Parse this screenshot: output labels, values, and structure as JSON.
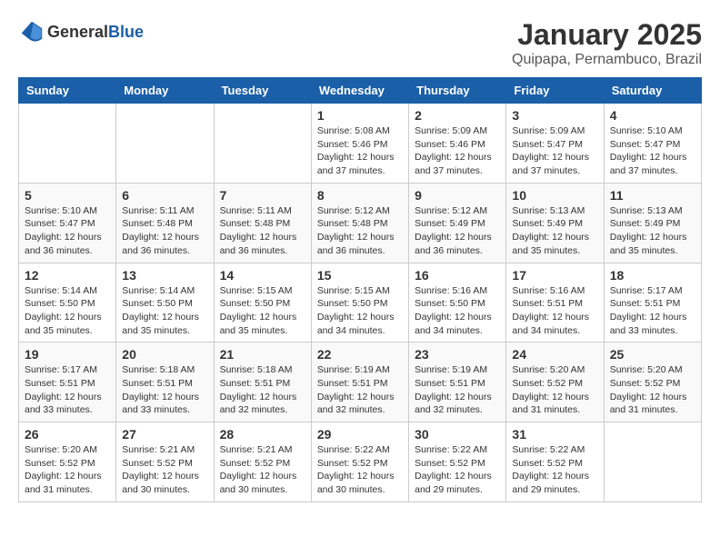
{
  "header": {
    "logo_general": "General",
    "logo_blue": "Blue",
    "title": "January 2025",
    "subtitle": "Quipapa, Pernambuco, Brazil"
  },
  "weekdays": [
    "Sunday",
    "Monday",
    "Tuesday",
    "Wednesday",
    "Thursday",
    "Friday",
    "Saturday"
  ],
  "weeks": [
    [
      {
        "day": "",
        "info": ""
      },
      {
        "day": "",
        "info": ""
      },
      {
        "day": "",
        "info": ""
      },
      {
        "day": "1",
        "info": "Sunrise: 5:08 AM\nSunset: 5:46 PM\nDaylight: 12 hours\nand 37 minutes."
      },
      {
        "day": "2",
        "info": "Sunrise: 5:09 AM\nSunset: 5:46 PM\nDaylight: 12 hours\nand 37 minutes."
      },
      {
        "day": "3",
        "info": "Sunrise: 5:09 AM\nSunset: 5:47 PM\nDaylight: 12 hours\nand 37 minutes."
      },
      {
        "day": "4",
        "info": "Sunrise: 5:10 AM\nSunset: 5:47 PM\nDaylight: 12 hours\nand 37 minutes."
      }
    ],
    [
      {
        "day": "5",
        "info": "Sunrise: 5:10 AM\nSunset: 5:47 PM\nDaylight: 12 hours\nand 36 minutes."
      },
      {
        "day": "6",
        "info": "Sunrise: 5:11 AM\nSunset: 5:48 PM\nDaylight: 12 hours\nand 36 minutes."
      },
      {
        "day": "7",
        "info": "Sunrise: 5:11 AM\nSunset: 5:48 PM\nDaylight: 12 hours\nand 36 minutes."
      },
      {
        "day": "8",
        "info": "Sunrise: 5:12 AM\nSunset: 5:48 PM\nDaylight: 12 hours\nand 36 minutes."
      },
      {
        "day": "9",
        "info": "Sunrise: 5:12 AM\nSunset: 5:49 PM\nDaylight: 12 hours\nand 36 minutes."
      },
      {
        "day": "10",
        "info": "Sunrise: 5:13 AM\nSunset: 5:49 PM\nDaylight: 12 hours\nand 35 minutes."
      },
      {
        "day": "11",
        "info": "Sunrise: 5:13 AM\nSunset: 5:49 PM\nDaylight: 12 hours\nand 35 minutes."
      }
    ],
    [
      {
        "day": "12",
        "info": "Sunrise: 5:14 AM\nSunset: 5:50 PM\nDaylight: 12 hours\nand 35 minutes."
      },
      {
        "day": "13",
        "info": "Sunrise: 5:14 AM\nSunset: 5:50 PM\nDaylight: 12 hours\nand 35 minutes."
      },
      {
        "day": "14",
        "info": "Sunrise: 5:15 AM\nSunset: 5:50 PM\nDaylight: 12 hours\nand 35 minutes."
      },
      {
        "day": "15",
        "info": "Sunrise: 5:15 AM\nSunset: 5:50 PM\nDaylight: 12 hours\nand 34 minutes."
      },
      {
        "day": "16",
        "info": "Sunrise: 5:16 AM\nSunset: 5:50 PM\nDaylight: 12 hours\nand 34 minutes."
      },
      {
        "day": "17",
        "info": "Sunrise: 5:16 AM\nSunset: 5:51 PM\nDaylight: 12 hours\nand 34 minutes."
      },
      {
        "day": "18",
        "info": "Sunrise: 5:17 AM\nSunset: 5:51 PM\nDaylight: 12 hours\nand 33 minutes."
      }
    ],
    [
      {
        "day": "19",
        "info": "Sunrise: 5:17 AM\nSunset: 5:51 PM\nDaylight: 12 hours\nand 33 minutes."
      },
      {
        "day": "20",
        "info": "Sunrise: 5:18 AM\nSunset: 5:51 PM\nDaylight: 12 hours\nand 33 minutes."
      },
      {
        "day": "21",
        "info": "Sunrise: 5:18 AM\nSunset: 5:51 PM\nDaylight: 12 hours\nand 32 minutes."
      },
      {
        "day": "22",
        "info": "Sunrise: 5:19 AM\nSunset: 5:51 PM\nDaylight: 12 hours\nand 32 minutes."
      },
      {
        "day": "23",
        "info": "Sunrise: 5:19 AM\nSunset: 5:51 PM\nDaylight: 12 hours\nand 32 minutes."
      },
      {
        "day": "24",
        "info": "Sunrise: 5:20 AM\nSunset: 5:52 PM\nDaylight: 12 hours\nand 31 minutes."
      },
      {
        "day": "25",
        "info": "Sunrise: 5:20 AM\nSunset: 5:52 PM\nDaylight: 12 hours\nand 31 minutes."
      }
    ],
    [
      {
        "day": "26",
        "info": "Sunrise: 5:20 AM\nSunset: 5:52 PM\nDaylight: 12 hours\nand 31 minutes."
      },
      {
        "day": "27",
        "info": "Sunrise: 5:21 AM\nSunset: 5:52 PM\nDaylight: 12 hours\nand 30 minutes."
      },
      {
        "day": "28",
        "info": "Sunrise: 5:21 AM\nSunset: 5:52 PM\nDaylight: 12 hours\nand 30 minutes."
      },
      {
        "day": "29",
        "info": "Sunrise: 5:22 AM\nSunset: 5:52 PM\nDaylight: 12 hours\nand 30 minutes."
      },
      {
        "day": "30",
        "info": "Sunrise: 5:22 AM\nSunset: 5:52 PM\nDaylight: 12 hours\nand 29 minutes."
      },
      {
        "day": "31",
        "info": "Sunrise: 5:22 AM\nSunset: 5:52 PM\nDaylight: 12 hours\nand 29 minutes."
      },
      {
        "day": "",
        "info": ""
      }
    ]
  ]
}
